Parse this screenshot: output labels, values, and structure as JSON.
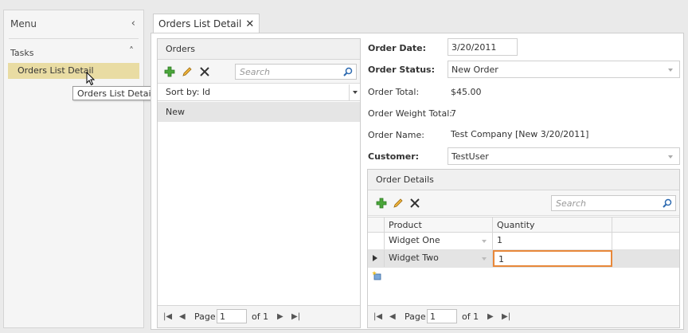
{
  "menu": {
    "title": "Menu",
    "collapse_glyph": "‹",
    "section": "Tasks",
    "section_chevron": "˄",
    "items": [
      {
        "label": "Orders List Detail"
      }
    ],
    "tooltip": "Orders List Detail"
  },
  "tab": {
    "label": "Orders List Detail",
    "close_glyph": "✕"
  },
  "orders": {
    "title": "Orders",
    "search_placeholder": "Search",
    "sort_label": "Sort by: Id",
    "rows": [
      {
        "label": "New"
      }
    ]
  },
  "pager": {
    "page_label": "Page",
    "page_value": "1",
    "of_label": "of 1"
  },
  "form": {
    "order_date_label": "Order Date:",
    "order_date_value": "3/20/2011",
    "order_status_label": "Order Status:",
    "order_status_value": "New Order",
    "order_total_label": "Order Total:",
    "order_total_value": "$45.00",
    "order_weight_label": "Order Weight Total:",
    "order_weight_value": "7",
    "order_name_label": "Order Name:",
    "order_name_value": "Test Company [New 3/20/2011]",
    "customer_label": "Customer:",
    "customer_value": "TestUser"
  },
  "details": {
    "title": "Order Details",
    "search_placeholder": "Search",
    "columns": [
      "Product",
      "Quantity"
    ],
    "rows": [
      {
        "product": "Widget One",
        "quantity": "1"
      },
      {
        "product": "Widget Two",
        "quantity": "1"
      }
    ]
  },
  "colors": {
    "selection": "#e9dca3",
    "edit_border": "#e8883a",
    "add_icon": "#4aa63a"
  }
}
